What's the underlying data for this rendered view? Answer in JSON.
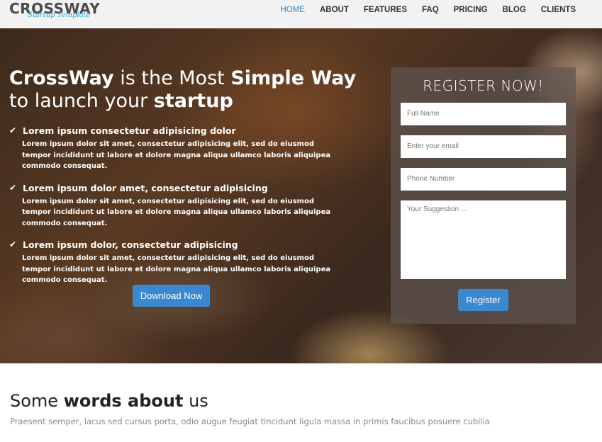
{
  "logo": {
    "main": "CROSSWAY",
    "tagline": "Startup Template"
  },
  "nav": {
    "items": [
      {
        "label": "HOME",
        "active": true
      },
      {
        "label": "ABOUT"
      },
      {
        "label": "FEATURES"
      },
      {
        "label": "FAQ"
      },
      {
        "label": "PRICING"
      },
      {
        "label": "BLOG"
      },
      {
        "label": "CLIENTS"
      }
    ]
  },
  "hero": {
    "title_part1": "CrossWay",
    "title_part2": " is the Most ",
    "title_part3": "Simple Way",
    "title_part4": " to launch your ",
    "title_part5": "startup",
    "features": [
      {
        "heading": "Lorem ipsum consectetur adipisicing dolor",
        "body": "Lorem ipsum dolor sit amet, consectetur adipisicing elit, sed do eiusmod tempor incididunt ut labore et dolore magna aliqua ullamco laboris aliquipea commodo consequat."
      },
      {
        "heading": "Lorem ipsum dolor amet, consectetur adipisicing",
        "body": "Lorem ipsum dolor sit amet, consectetur adipisicing elit, sed do eiusmod tempor incididunt ut labore et dolore magna aliqua ullamco laboris aliquipea commodo consequat."
      },
      {
        "heading": "Lorem ipsum dolor, consectetur adipisicing",
        "body": "Lorem ipsum dolor sit amet, consectetur adipisicing elit, sed do eiusmod tempor incididunt ut labore et dolore magna aliqua ullamco laboris aliquipea commodo consequat."
      }
    ],
    "download_label": "Download Now"
  },
  "register": {
    "title": "REGISTER NOW!",
    "full_name_placeholder": "Full Name",
    "email_placeholder": "Enter your email",
    "phone_placeholder": "Phone Number",
    "suggestion_placeholder": "Your Suggestion ...",
    "button_label": "Register"
  },
  "about": {
    "title_part1": "Some ",
    "title_part2": "words about",
    "title_part3": " us",
    "subtitle": "Praesent semper, lacus sed cursus porta, odio augue feugiat tincidunt ligula massa in primis faucibus posuere cubilia"
  },
  "colors": {
    "accent": "#3a88cf",
    "nav_active": "#3a7fc4"
  }
}
